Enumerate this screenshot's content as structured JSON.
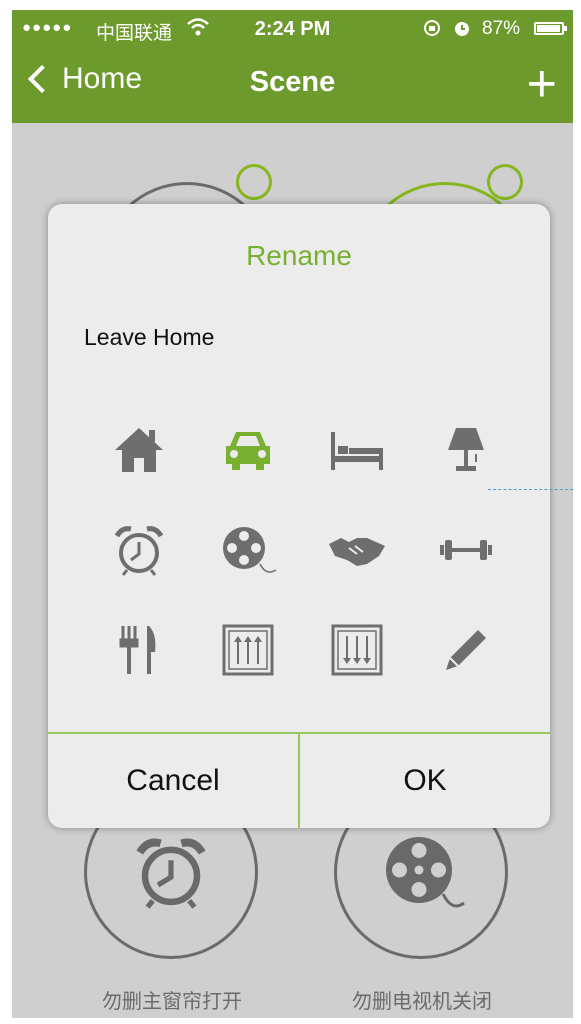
{
  "status_bar": {
    "signal": "●●●●●",
    "carrier": "中国联通",
    "time": "2:24 PM",
    "battery": "87%"
  },
  "nav": {
    "back_label": "Home",
    "title": "Scene",
    "add_label": "+"
  },
  "scenes": [
    {
      "label": "勿删主窗帘打开",
      "icon": "alarm-clock-icon"
    },
    {
      "label": "勿删电视机关闭",
      "icon": "film-reel-icon"
    }
  ],
  "dialog": {
    "title": "Rename",
    "scene_name": "Leave Home",
    "icons": [
      {
        "name": "home-icon",
        "selected": false
      },
      {
        "name": "car-icon",
        "selected": true
      },
      {
        "name": "bed-icon",
        "selected": false
      },
      {
        "name": "lamp-icon",
        "selected": false
      },
      {
        "name": "alarm-clock-icon",
        "selected": false
      },
      {
        "name": "film-reel-icon",
        "selected": false
      },
      {
        "name": "handshake-icon",
        "selected": false
      },
      {
        "name": "dumbbell-icon",
        "selected": false
      },
      {
        "name": "fork-knife-icon",
        "selected": false
      },
      {
        "name": "sliders-up-icon",
        "selected": false
      },
      {
        "name": "sliders-down-icon",
        "selected": false
      },
      {
        "name": "pencil-icon",
        "selected": false
      }
    ],
    "cancel_label": "Cancel",
    "ok_label": "OK"
  },
  "colors": {
    "brand_green": "#6c9a2c",
    "accent_green": "#7ab032",
    "icon_gray": "#6e6e6e"
  }
}
